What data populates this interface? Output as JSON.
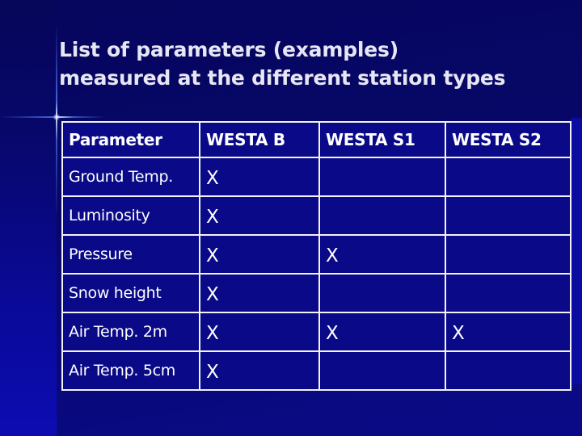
{
  "slide": {
    "title_lines": [
      "List of parameters (examples)",
      "measured at the different station types"
    ]
  },
  "table": {
    "headers": [
      "Parameter",
      "WESTA B",
      "WESTA S1",
      "WESTA S2"
    ],
    "rows": [
      {
        "parameter": "Ground Temp.",
        "westa_b": "X",
        "westa_s1": "",
        "westa_s2": ""
      },
      {
        "parameter": "Luminosity",
        "westa_b": "X",
        "westa_s1": "",
        "westa_s2": ""
      },
      {
        "parameter": "Pressure",
        "westa_b": "X",
        "westa_s1": "X",
        "westa_s2": ""
      },
      {
        "parameter": "Snow height",
        "westa_b": "X",
        "westa_s1": "",
        "westa_s2": ""
      },
      {
        "parameter": "Air Temp. 2m",
        "westa_b": "X",
        "westa_s1": "X",
        "westa_s2": "X"
      },
      {
        "parameter": "Air Temp. 5cm",
        "westa_b": "X",
        "westa_s1": "",
        "westa_s2": ""
      }
    ]
  },
  "colors": {
    "background": "#08086a",
    "title_text": "#e6e6f4",
    "table_fill": "#0a0a88",
    "table_border": "#f2f2f8",
    "cell_text": "#ffffff"
  }
}
